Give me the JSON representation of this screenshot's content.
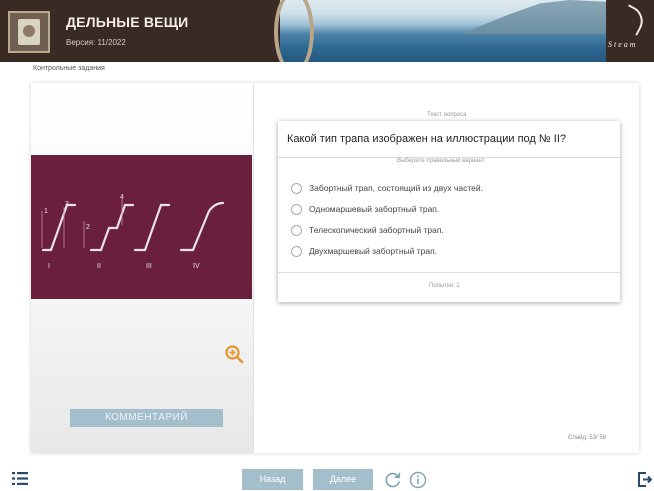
{
  "header": {
    "title": "ДЕЛЬНЫЕ ВЕЩИ",
    "version": "Версия: 11/2022",
    "logo_text": "Steam"
  },
  "breadcrumb": "Контрольные задания",
  "illustration": {
    "labels": [
      "I",
      "II",
      "III",
      "IV"
    ],
    "numbers": [
      "1",
      "2",
      "3",
      "4"
    ],
    "zoom_icon": "zoom-in-icon",
    "background": "#6a1f3d",
    "accent": "#e8962f"
  },
  "comment_button": "КОММЕНТАРИЙ",
  "question": {
    "hint": "Текст вопроса",
    "text": "Какой тип трапа изображен на иллюстрации под № II?",
    "answer_hint": "Выберите правильный вариант",
    "options": [
      "Забортный трап, состоящий из двух частей.",
      "Одномаршевый забортный трап.",
      "Телескопический забортный трап.",
      "Двухмаршевый забортный трап."
    ],
    "attempts": "Попытки: 1"
  },
  "slide_counter": "Слайд: 53/ 58",
  "nav": {
    "back": "Назад",
    "next": "Далее",
    "button_color": "#a3bfcc"
  }
}
